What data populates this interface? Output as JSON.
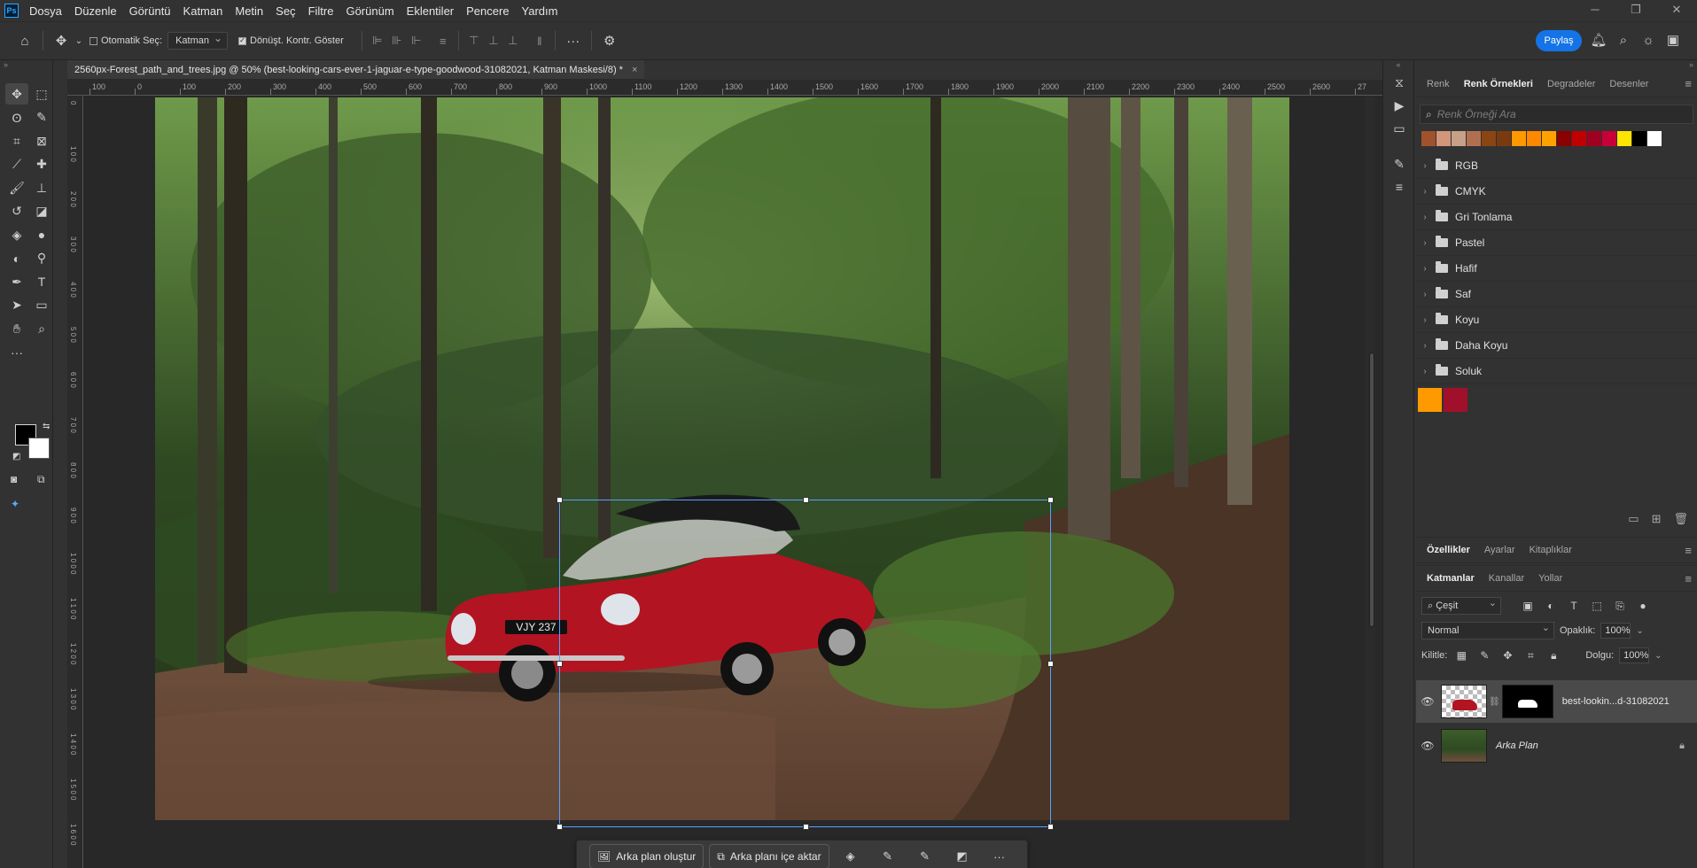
{
  "app": {
    "logo": "Ps",
    "menu": [
      "Dosya",
      "Düzenle",
      "Görüntü",
      "Katman",
      "Metin",
      "Seç",
      "Filtre",
      "Görünüm",
      "Eklentiler",
      "Pencere",
      "Yardım"
    ]
  },
  "options_bar": {
    "auto_select_label": "Otomatik Seç:",
    "auto_select_checked": false,
    "layer_select_value": "Katman",
    "transform_controls_label": "Dönüşt. Kontr. Göster",
    "transform_controls_checked": true,
    "share_label": "Paylaş"
  },
  "document": {
    "tab_title": "2560px-Forest_path_and_trees.jpg @ 50% (best-looking-cars-ever-1-jaguar-e-type-goodwood-31082021, Katman Maskesi/8) *",
    "close": "×",
    "zoom": "50%"
  },
  "rulers": {
    "h_labels": [
      "100",
      "0",
      "100",
      "200",
      "300",
      "400",
      "500",
      "600",
      "700",
      "800",
      "900",
      "1000",
      "1100",
      "1200",
      "1300",
      "1400",
      "1500",
      "1600",
      "1700",
      "1800",
      "1900",
      "2000",
      "2100",
      "2200",
      "2300",
      "2400",
      "2500",
      "2600",
      "27"
    ],
    "v_labels": [
      "0",
      "1 0 0",
      "2 0 0",
      "3 0 0",
      "4 0 0",
      "5 0 0",
      "6 0 0",
      "7 0 0",
      "8 0 0",
      "9 0 0",
      "1 0 0 0",
      "1 1 0 0",
      "1 2 0 0",
      "1 3 0 0",
      "1 4 0 0",
      "1 5 0 0",
      "1 6 0 0"
    ]
  },
  "canvas_image": {
    "plate": "VJY 237"
  },
  "contextual_bar": {
    "generate_bg": "Arka plan oluştur",
    "import_bg": "Arka planı içe aktar",
    "more": "···"
  },
  "swatches_panel": {
    "tabs": [
      "Renk",
      "Renk Örnekleri",
      "Degradeler",
      "Desenler"
    ],
    "active_tab": "Renk Örnekleri",
    "search_placeholder": "Renk Örneği Ara",
    "recent_colors": [
      "#a0522d",
      "#d2967a",
      "#c8a088",
      "#b07050",
      "#8b4513",
      "#7a3a10",
      "#ff9900",
      "#ff8800",
      "#ffa200",
      "#8b0000",
      "#c00000",
      "#a00020",
      "#c8003a",
      "#ffe400",
      "#000000",
      "#ffffff"
    ],
    "groups": [
      "RGB",
      "CMYK",
      "Gri Tonlama",
      "Pastel",
      "Hafif",
      "Saf",
      "Koyu",
      "Daha Koyu",
      "Soluk"
    ],
    "loose_swatches": [
      "#ff9900",
      "#a0102a"
    ]
  },
  "properties_tabs": [
    "Özellikler",
    "Ayarlar",
    "Kitaplıklar"
  ],
  "layers_panel": {
    "tabs": [
      "Katmanlar",
      "Kanallar",
      "Yollar"
    ],
    "filter_value": "Çeşit",
    "blend_mode": "Normal",
    "opacity_label": "Opaklık:",
    "opacity_value": "100%",
    "lock_label": "Kilitle:",
    "fill_label": "Dolgu:",
    "fill_value": "100%",
    "layers": [
      {
        "name": "best-lookin...d-31082021",
        "selected": true,
        "has_mask": true,
        "locked": false
      },
      {
        "name": "Arka Plan",
        "selected": false,
        "has_mask": false,
        "locked": true
      }
    ]
  },
  "colors": {
    "accent": "#1473e6",
    "foreground": "#000000",
    "background": "#ffffff",
    "selection": "#5aa0ff"
  }
}
